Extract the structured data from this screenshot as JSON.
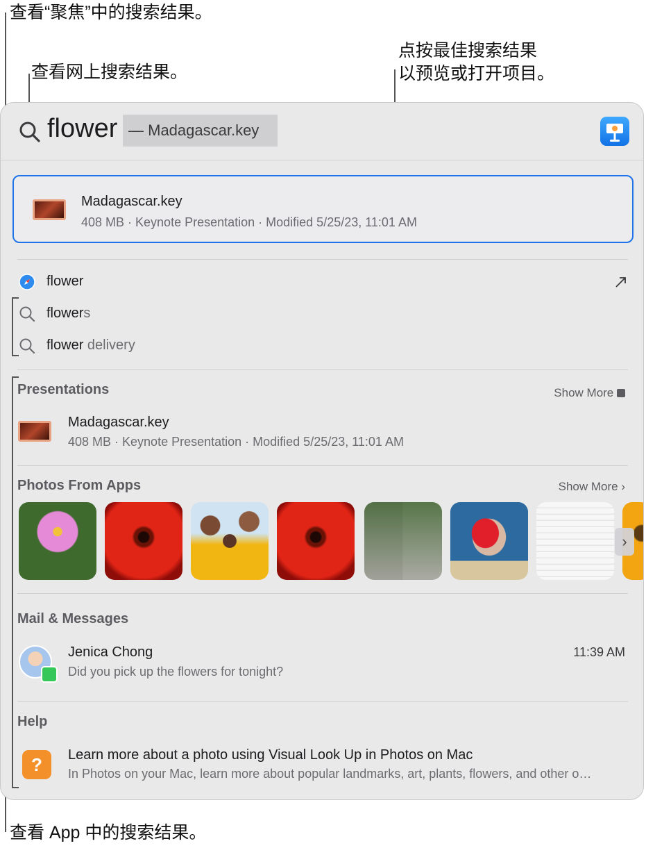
{
  "callouts": {
    "spotlight": "查看“聚焦”中的搜索结果。",
    "web": "查看网上搜索结果。",
    "top_hit_1": "点按最佳搜索结果",
    "top_hit_2": "以预览或打开项目。",
    "app_results": "查看 App 中的搜索结果。"
  },
  "search": {
    "query": "flower",
    "completion": "— Madagascar.key",
    "app_icon": "keynote-icon"
  },
  "top_hit": {
    "title": "Madagascar.key",
    "subtitle": "408 MB · Keynote Presentation · Modified 5/25/23, 11:01 AM",
    "icon": "keynote-thumbnail"
  },
  "suggestions": [
    {
      "icon": "safari-icon",
      "bold": "flower",
      "rest": "",
      "action_icon": "open-arrow-icon"
    },
    {
      "icon": "search-icon",
      "bold": "flower",
      "rest": "s"
    },
    {
      "icon": "search-icon",
      "bold": "flower",
      "rest": " delivery"
    }
  ],
  "presentations": {
    "title": "Presentations",
    "show_more": "Show More",
    "item_title": "Madagascar.key",
    "item_sub": "408 MB · Keynote Presentation · Modified 5/25/23, 11:01 AM"
  },
  "photos": {
    "title": "Photos From Apps",
    "show_more": "Show More ›",
    "items": [
      "pink-cosmos-photo",
      "red-gerbera-photo",
      "friends-sunflowers-photo",
      "red-gerbera-photo",
      "interior-collage-photo",
      "person-anthurium-photo",
      "document-screenshot",
      "sunflower-photo"
    ]
  },
  "mail": {
    "title": "Mail & Messages",
    "sender": "Jenica Chong",
    "time": "11:39 AM",
    "preview": "Did you pick up the flowers for tonight?"
  },
  "help": {
    "title": "Help",
    "item_title": "Learn more about a photo using Visual Look Up in Photos on Mac",
    "item_sub": "In Photos on your Mac, learn more about popular landmarks, art, plants, flowers, and other o…"
  },
  "colors": {
    "accent": "#1e74e8",
    "panel": "#e9e9ea",
    "messages_green": "#35c759",
    "help_orange": "#f4902a"
  }
}
